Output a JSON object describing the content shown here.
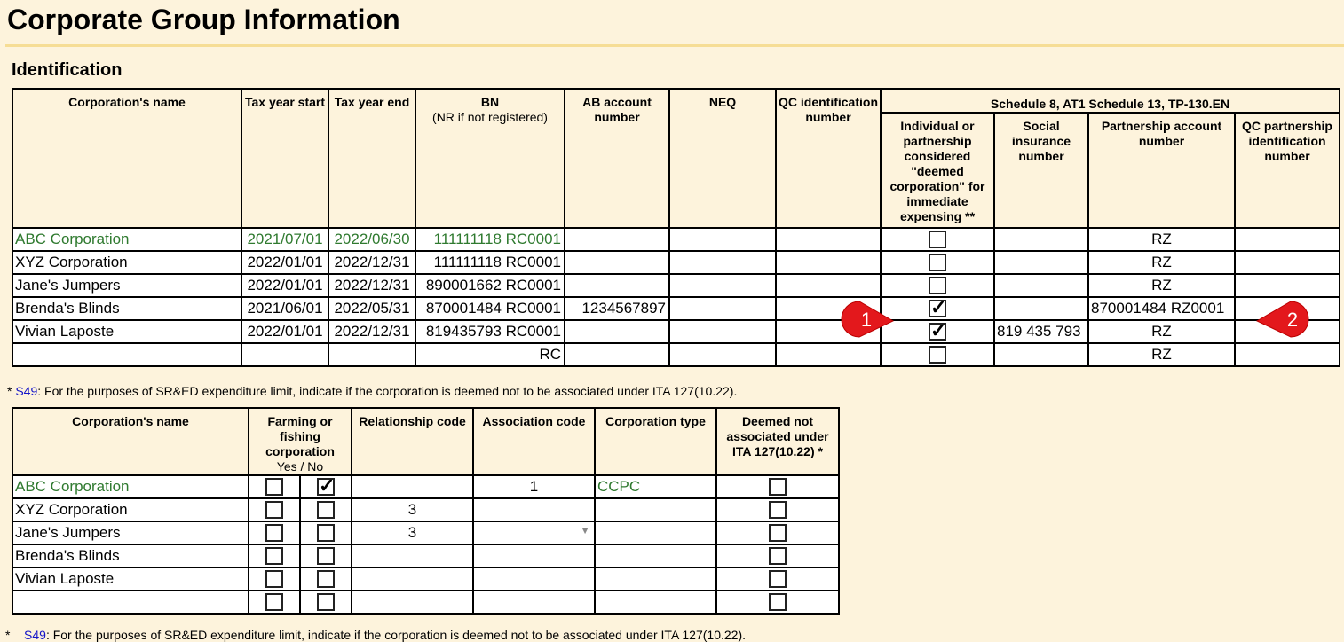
{
  "page_title": "Corporate Group Information",
  "section_title": "Identification",
  "table1": {
    "headers": {
      "name": "Corporation's name",
      "tax_year_start": "Tax year start",
      "tax_year_end": "Tax year end",
      "bn": "BN",
      "bn_sub": "(NR if not registered)",
      "ab_account": "AB account number",
      "neq": "NEQ",
      "qc_id": "QC identification number",
      "schedule_group": "Schedule 8, AT1 Schedule 13, TP-130.EN",
      "deemed_corp": "Individual or partnership considered \"deemed corporation\" for immediate expensing **",
      "sin": "Social insurance number",
      "partnership_acct": "Partnership account number",
      "qc_partnership_id": "QC partnership identification number"
    },
    "rows": [
      {
        "name": "ABC Corporation",
        "start": "2021/07/01",
        "end": "2022/06/30",
        "bn": "111111118 RC0001",
        "ab": "",
        "neq": "",
        "qc": "",
        "deemed": false,
        "sin": "",
        "pacct": "RZ",
        "qcp": ""
      },
      {
        "name": "XYZ Corporation",
        "start": "2022/01/01",
        "end": "2022/12/31",
        "bn": "111111118 RC0001",
        "ab": "",
        "neq": "",
        "qc": "",
        "deemed": false,
        "sin": "",
        "pacct": "RZ",
        "qcp": ""
      },
      {
        "name": "Jane's Jumpers",
        "start": "2022/01/01",
        "end": "2022/12/31",
        "bn": "890001662 RC0001",
        "ab": "",
        "neq": "",
        "qc": "",
        "deemed": false,
        "sin": "",
        "pacct": "RZ",
        "qcp": ""
      },
      {
        "name": "Brenda's Blinds",
        "start": "2021/06/01",
        "end": "2022/05/31",
        "bn": "870001484 RC0001",
        "ab": "1234567897",
        "neq": "",
        "qc": "",
        "deemed": true,
        "sin": "",
        "pacct": "870001484 RZ0001",
        "qcp": ""
      },
      {
        "name": "Vivian Laposte",
        "start": "2022/01/01",
        "end": "2022/12/31",
        "bn": "819435793 RC0001",
        "ab": "",
        "neq": "",
        "qc": "",
        "deemed": true,
        "sin": "819 435 793",
        "pacct": "RZ",
        "qcp": ""
      },
      {
        "name": "",
        "start": "",
        "end": "",
        "bn": "RC",
        "ab": "",
        "neq": "",
        "qc": "",
        "deemed": false,
        "sin": "",
        "pacct": "RZ",
        "qcp": ""
      }
    ]
  },
  "note1": {
    "prefix": "* ",
    "link": "S49",
    "text": ": For the purposes of SR&ED expenditure limit, indicate if the corporation is deemed not to be associated under ITA 127(10.22)."
  },
  "table2": {
    "headers": {
      "name": "Corporation's name",
      "farming": "Farming or fishing corporation",
      "yes_no": "Yes / No",
      "relationship": "Relationship code",
      "association": "Association code",
      "corp_type": "Corporation type",
      "deemed_not": "Deemed not associated under ITA 127(10.22) *"
    },
    "rows": [
      {
        "name": "ABC Corporation",
        "yes": false,
        "no": true,
        "relationship": "",
        "association": "1",
        "corp_type": "CCPC",
        "deemed_not": false
      },
      {
        "name": "XYZ Corporation",
        "yes": false,
        "no": false,
        "relationship": "3",
        "association": "",
        "corp_type": "",
        "deemed_not": false
      },
      {
        "name": "Jane's Jumpers",
        "yes": false,
        "no": false,
        "relationship": "3",
        "association": "",
        "corp_type": "",
        "deemed_not": false
      },
      {
        "name": "Brenda's Blinds",
        "yes": false,
        "no": false,
        "relationship": "",
        "association": "",
        "corp_type": "",
        "deemed_not": false
      },
      {
        "name": "Vivian Laposte",
        "yes": false,
        "no": false,
        "relationship": "",
        "association": "",
        "corp_type": "",
        "deemed_not": false
      },
      {
        "name": "",
        "yes": false,
        "no": false,
        "relationship": "",
        "association": "",
        "corp_type": "",
        "deemed_not": false
      }
    ]
  },
  "note2": {
    "prefix": "*",
    "link": "S49",
    "text": ": For the purposes of SR&ED expenditure limit, indicate if the corporation is deemed not to be associated under ITA 127(10.22)."
  },
  "callouts": [
    {
      "label": "1",
      "color": "#e3181c"
    },
    {
      "label": "2",
      "color": "#e3181c"
    }
  ],
  "checkmark_glyph": "✓",
  "colors": {
    "highlight_teal": "#c3e6df",
    "green_text": "#2f7a2f",
    "page_bg": "#fdf3dc",
    "link": "#1515c8"
  }
}
